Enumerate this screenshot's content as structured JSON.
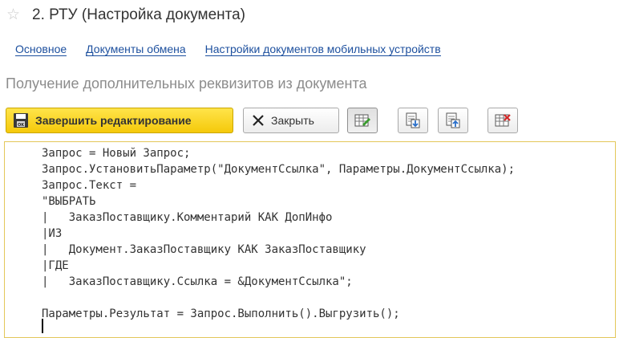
{
  "window": {
    "title": "2. РТУ (Настройка документа)"
  },
  "tabs": [
    {
      "label": "Основное"
    },
    {
      "label": "Документы обмена"
    },
    {
      "label": "Настройки документов мобильных устройств"
    }
  ],
  "section": {
    "title": "Получение дополнительных реквизитов из документа"
  },
  "toolbar": {
    "finish_label": "Завершить редактирование",
    "close_label": "Закрыть",
    "icons": [
      "edit-table-icon",
      "import-document-icon",
      "export-document-icon",
      "delete-table-icon"
    ]
  },
  "editor": {
    "lines": [
      "Запрос = Новый Запрос;",
      "Запрос.УстановитьПараметр(\"ДокументСсылка\", Параметры.ДокументСсылка);",
      "Запрос.Текст =",
      "\"ВЫБРАТЬ",
      "|   ЗаказПоставщику.Комментарий КАК ДопИнфо",
      "|ИЗ",
      "|   Документ.ЗаказПоставщику КАК ЗаказПоставщику",
      "|ГДЕ",
      "|   ЗаказПоставщику.Ссылка = &ДокументСсылка\";",
      "",
      "Параметры.Результат = Запрос.Выполнить().Выгрузить();"
    ]
  },
  "colors": {
    "accent_yellow": "#f5c90a",
    "link_blue": "#1c4f9e",
    "subtitle_gray": "#8c8c8c"
  }
}
